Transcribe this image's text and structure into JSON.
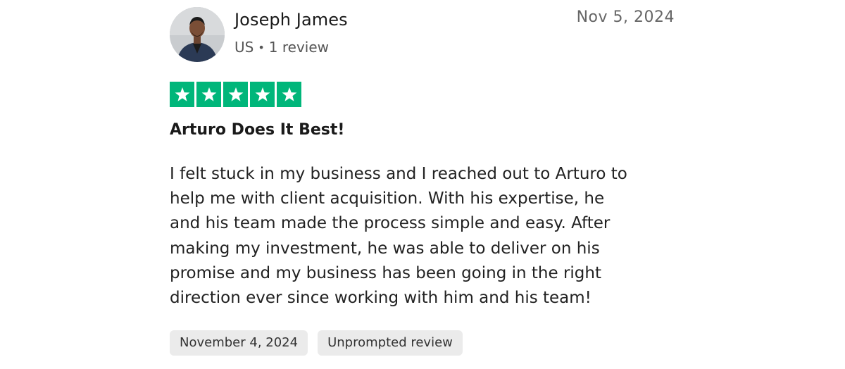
{
  "review": {
    "reviewer": {
      "name": "Joseph James",
      "country": "US",
      "separator": "•",
      "review_count": "1 review"
    },
    "date": "Nov 5, 2024",
    "rating": 5,
    "rating_max": 5,
    "star_color": "#00b67a",
    "title": "Arturo Does It Best!",
    "body": "I felt stuck in my business and I reached out to Arturo to help me with client acquisition. With his expertise, he and his team made the process simple and easy. After making my investment, he was able to deliver on his promise and my business has been going in the right direction ever since working with him and his team!",
    "tags": [
      "November 4, 2024",
      "Unprompted review"
    ]
  }
}
